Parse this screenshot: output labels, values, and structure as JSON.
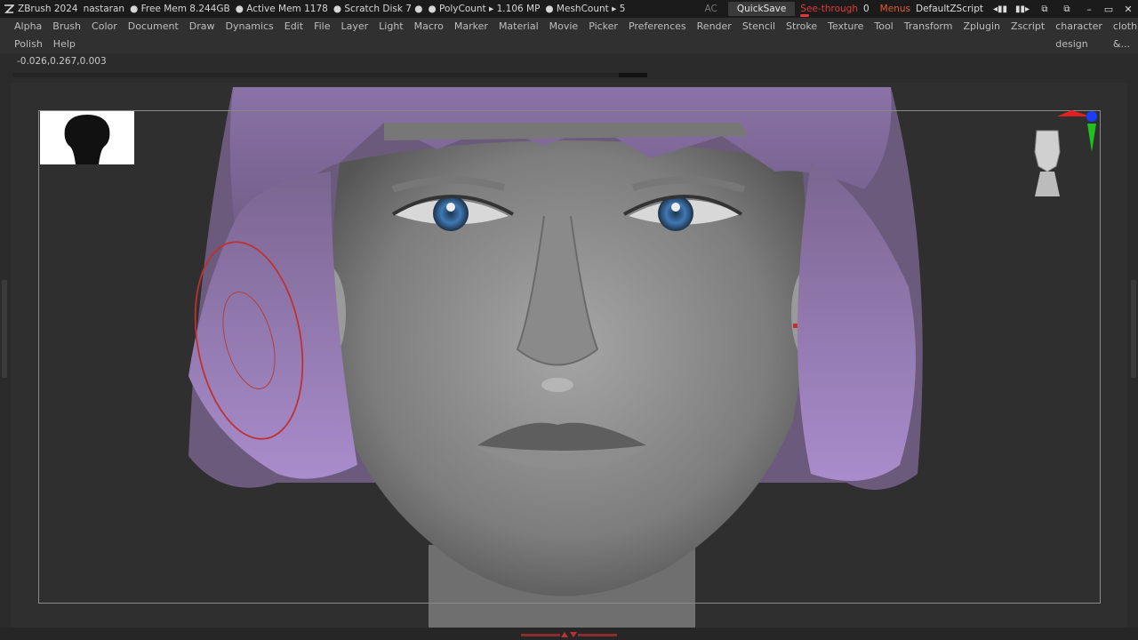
{
  "titlebar": {
    "app": "ZBrush 2024",
    "user": "nastaran",
    "free_mem": "● Free Mem 8.244GB",
    "active_mem": "● Active Mem 1178",
    "scratch": "● Scratch Disk 7 ●",
    "polycount": "● PolyCount ▸ 1.106 MP",
    "meshcount": "● MeshCount ▸ 5",
    "ac": "AC",
    "quicksave": "QuickSave",
    "see_through": "See-through",
    "see_through_value": "0",
    "menus": "Menus",
    "script": "DefaultZScript"
  },
  "menu": {
    "row1": [
      "Alpha",
      "Brush",
      "Color",
      "Document",
      "Draw",
      "Dynamics",
      "Edit",
      "File",
      "Layer",
      "Light",
      "Macro",
      "Marker",
      "Material",
      "Movie",
      "Picker",
      "Preferences",
      "Render",
      "Stencil",
      "Stroke",
      "Texture",
      "Tool",
      "Transform",
      "Zplugin",
      "Zscript",
      "character design",
      "cloth &..."
    ],
    "row2": [
      "Polish",
      "Help"
    ]
  },
  "coords": "-0.026,0.267,0.003",
  "colors": {
    "accent_red": "#e23a3a",
    "menus_orange": "#e55a2b",
    "hair": "#9a80b8",
    "skin": "#8d8d8d"
  },
  "icons": [
    "zbrush-logo-icon",
    "undock-icon",
    "dock-icon",
    "minimize-icon",
    "maximize-icon",
    "close-icon",
    "head-navigation-icon",
    "axis-gizmo-icon"
  ]
}
